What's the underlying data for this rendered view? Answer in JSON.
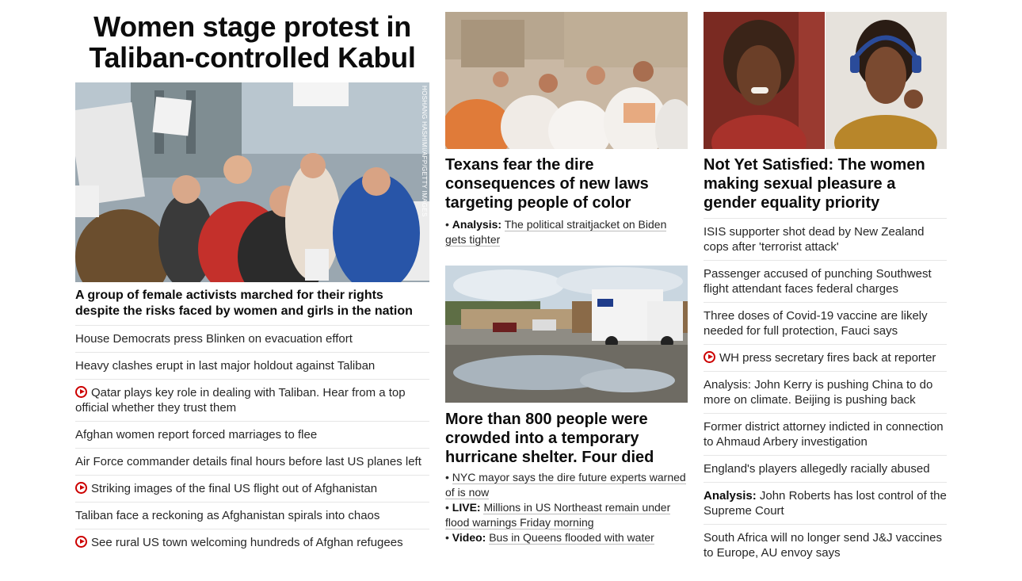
{
  "left": {
    "headline": "Women stage protest in Taliban-controlled Kabul",
    "image_credit": "HOSHANG HASHIMI/AFP/GETTY IMAGES",
    "caption": "A group of female activists marched for their rights despite the risks faced by women and girls in the nation",
    "stories": [
      {
        "text": "House Democrats press Blinken on evacuation effort",
        "video": false
      },
      {
        "text": "Heavy clashes erupt in last major holdout against Taliban",
        "video": false
      },
      {
        "text": "Qatar plays key role in dealing with Taliban. Hear from a top official whether they trust them",
        "video": true
      },
      {
        "text": "Afghan women report forced marriages to flee",
        "video": false
      },
      {
        "text": "Air Force commander details final hours before last US planes left",
        "video": false
      },
      {
        "text": "Striking images of the final US flight out of Afghanistan",
        "video": true
      },
      {
        "text": "Taliban face a reckoning as Afghanistan spirals into chaos",
        "video": false
      },
      {
        "text": "See rural US town welcoming hundreds of Afghan refugees",
        "video": true
      }
    ]
  },
  "mid": {
    "card1": {
      "headline": "Texans fear the dire consequences of new laws targeting people of color",
      "links": [
        {
          "label": "Analysis:",
          "text": "The political straitjacket on Biden gets tighter"
        }
      ]
    },
    "card2": {
      "headline": "More than 800 people were crowded into a temporary hurricane shelter. Four died",
      "links": [
        {
          "label": "",
          "text": "NYC mayor says the dire future experts warned of is now"
        },
        {
          "label": "LIVE:",
          "text": "Millions in US Northeast remain under flood warnings Friday morning"
        },
        {
          "label": "Video:",
          "text": "Bus in Queens flooded with water"
        }
      ]
    }
  },
  "right": {
    "headline": "Not Yet Satisfied: The women making sexual pleasure a gender equality priority",
    "stories": [
      {
        "label": "",
        "text": "ISIS supporter shot dead by New Zealand cops after 'terrorist attack'",
        "video": false
      },
      {
        "label": "",
        "text": "Passenger accused of punching Southwest flight attendant faces federal charges",
        "video": false
      },
      {
        "label": "",
        "text": "Three doses of Covid-19 vaccine are likely needed for full protection, Fauci says",
        "video": false
      },
      {
        "label": "",
        "text": "WH press secretary fires back at reporter",
        "video": true
      },
      {
        "label": "",
        "text": "Analysis: John Kerry is pushing China to do more on climate. Beijing is pushing back",
        "video": false
      },
      {
        "label": "",
        "text": "Former district attorney indicted in connection to Ahmaud Arbery investigation",
        "video": false
      },
      {
        "label": "",
        "text": "England's players allegedly racially abused",
        "video": false
      },
      {
        "label": "Analysis:",
        "text": "John Roberts has lost control of the Supreme Court",
        "video": false
      },
      {
        "label": "",
        "text": "South Africa will no longer send J&J vaccines to Europe, AU envoy says",
        "video": false
      }
    ]
  },
  "colors": {
    "video_icon": "#cc0000",
    "divider": "#e6e6e6",
    "text": "#0c0c0c"
  }
}
